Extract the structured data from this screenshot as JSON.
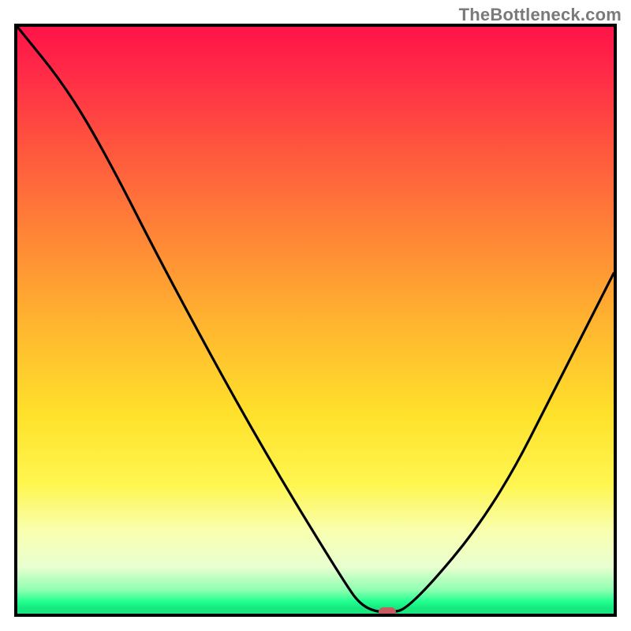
{
  "watermark": "TheBottleneck.com",
  "colors": {
    "border": "#000000",
    "curve": "#000000",
    "marker": "#c95b62",
    "gradient_top": "#ff1449",
    "gradient_bottom": "#18e880"
  },
  "chart_data": {
    "type": "line",
    "title": "",
    "xlabel": "",
    "ylabel": "",
    "xlim": [
      0,
      100
    ],
    "ylim": [
      0,
      100
    ],
    "grid": false,
    "series": [
      {
        "name": "bottleneck-curve",
        "x": [
          0,
          8,
          15,
          25,
          40,
          55,
          58,
          62,
          66,
          80,
          92,
          100
        ],
        "values": [
          100,
          90,
          78,
          58,
          30,
          5,
          1,
          0,
          1,
          18,
          42,
          58
        ]
      }
    ],
    "annotations": [
      {
        "name": "optimum-marker",
        "x": 62,
        "y": 0
      }
    ]
  }
}
